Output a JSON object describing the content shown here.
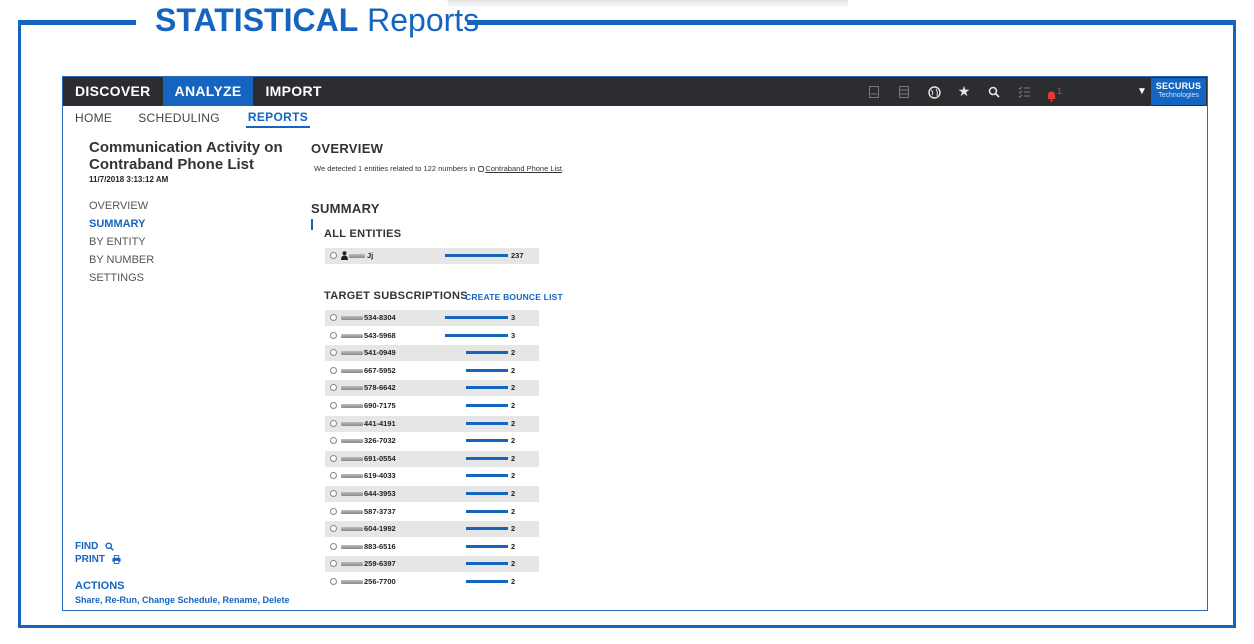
{
  "banner": {
    "title_bold": "STATISTICAL",
    "title_rest": " Reports"
  },
  "topnav": {
    "tabs": [
      {
        "label": "DISCOVER",
        "active": false
      },
      {
        "label": "ANALYZE",
        "active": true
      },
      {
        "label": "IMPORT",
        "active": false
      }
    ],
    "icons": [
      "document-icon",
      "spreadsheet-icon",
      "globe-icon",
      "star-icon",
      "search-icon",
      "checklist-icon",
      "bell-icon"
    ],
    "notification_count": "1",
    "brand_name": "SECURUS",
    "brand_sub": "Technologies"
  },
  "subnav": {
    "tabs": [
      {
        "label": "HOME",
        "active": false
      },
      {
        "label": "SCHEDULING",
        "active": false
      },
      {
        "label": "REPORTS",
        "active": true
      }
    ]
  },
  "report": {
    "title": "Communication Activity on Contraband Phone List",
    "date": "11/7/2018 3:13:12 AM",
    "nav": [
      {
        "label": "OVERVIEW",
        "active": false
      },
      {
        "label": "SUMMARY",
        "active": true
      },
      {
        "label": "BY ENTITY",
        "active": false
      },
      {
        "label": "BY NUMBER",
        "active": false
      },
      {
        "label": "SETTINGS",
        "active": false
      }
    ],
    "find_label": "FIND",
    "print_label": "PRINT",
    "actions_title": "ACTIONS",
    "actions_links": "Share, Re-Run, Change Schedule, Rename, Delete"
  },
  "overview": {
    "heading": "OVERVIEW",
    "text_before": "We detected 1 entities related to 122 numbers in ",
    "list_link": "Contraband Phone List",
    "text_after": "."
  },
  "summary": {
    "heading": "SUMMARY",
    "all_entities_heading": "ALL ENTITIES",
    "entities": [
      {
        "label": "Jj",
        "value": 237
      }
    ],
    "target_heading": "TARGET SUBSCRIPTIONS",
    "create_bounce_label": "CREATE BOUNCE LIST",
    "subscriptions": [
      {
        "label": "534-8304",
        "value": 3
      },
      {
        "label": "543-5968",
        "value": 3
      },
      {
        "label": "541-0949",
        "value": 2
      },
      {
        "label": "667-5952",
        "value": 2
      },
      {
        "label": "578-6642",
        "value": 2
      },
      {
        "label": "690-7175",
        "value": 2
      },
      {
        "label": "441-4191",
        "value": 2
      },
      {
        "label": "326-7032",
        "value": 2
      },
      {
        "label": "691-0554",
        "value": 2
      },
      {
        "label": "619-4033",
        "value": 2
      },
      {
        "label": "644-3953",
        "value": 2
      },
      {
        "label": "587-3737",
        "value": 2
      },
      {
        "label": "604-1992",
        "value": 2
      },
      {
        "label": "883-6516",
        "value": 2
      },
      {
        "label": "259-6397",
        "value": 2
      },
      {
        "label": "256-7700",
        "value": 2
      }
    ]
  },
  "colors": {
    "accent": "#1565c0",
    "nav_bg": "#2b2d30",
    "row_shade": "#e6e6e6",
    "alert": "#e53935"
  }
}
